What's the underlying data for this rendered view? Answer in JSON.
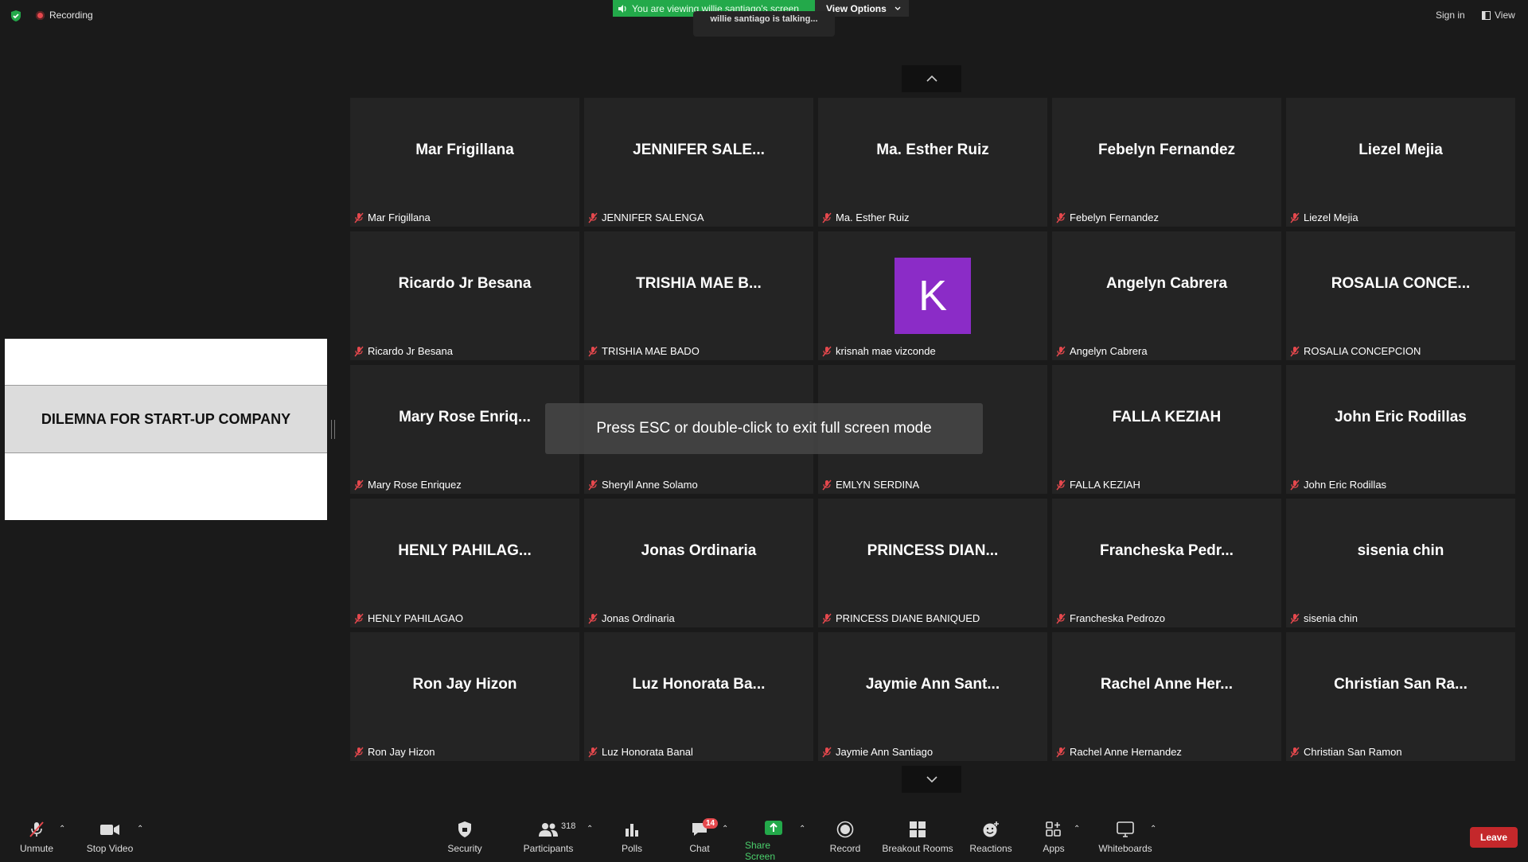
{
  "top": {
    "recording_label": "Recording",
    "viewing_text": "You are viewing willie santiago's screen",
    "view_options_label": "View Options",
    "talking_text": "willie santiago is talking...",
    "sign_in_label": "Sign in",
    "view_label": "View"
  },
  "share": {
    "slide_title": "DILEMNA FOR START-UP COMPANY"
  },
  "toast": {
    "text": "Press ESC or double-click to exit full screen mode"
  },
  "participants": [
    {
      "display": "Mar Frigillana",
      "label": "Mar Frigillana"
    },
    {
      "display": "JENNIFER  SALE...",
      "label": "JENNIFER SALENGA"
    },
    {
      "display": "Ma. Esther Ruiz",
      "label": "Ma. Esther Ruiz"
    },
    {
      "display": "Febelyn Fernandez",
      "label": "Febelyn Fernandez"
    },
    {
      "display": "Liezel Mejia",
      "label": "Liezel Mejia"
    },
    {
      "display": "Ricardo Jr Besana",
      "label": "Ricardo Jr Besana"
    },
    {
      "display": "TRISHIA MAE B...",
      "label": "TRISHIA MAE BADO"
    },
    {
      "display": "K",
      "label": "krisnah mae vizconde",
      "avatar": true
    },
    {
      "display": "Angelyn Cabrera",
      "label": "Angelyn Cabrera"
    },
    {
      "display": "ROSALIA  CONCE...",
      "label": "ROSALIA CONCEPCION"
    },
    {
      "display": "Mary Rose Enriq...",
      "label": "Mary Rose Enriquez"
    },
    {
      "display": "",
      "label": "Sheryll Anne Solamo"
    },
    {
      "display": "",
      "label": "EMLYN SERDINA"
    },
    {
      "display": "FALLA KEZIAH",
      "label": "FALLA KEZIAH"
    },
    {
      "display": "John Eric Rodillas",
      "label": "John Eric Rodillas"
    },
    {
      "display": "HENLY  PAHILAG...",
      "label": "HENLY PAHILAGAO"
    },
    {
      "display": "Jonas Ordinaria",
      "label": "Jonas Ordinaria"
    },
    {
      "display": "PRINCESS  DIAN...",
      "label": "PRINCESS DIANE BANIQUED"
    },
    {
      "display": "Francheska  Pedr...",
      "label": "Francheska Pedrozo"
    },
    {
      "display": "sisenia chin",
      "label": "sisenia chin"
    },
    {
      "display": "Ron Jay Hizon",
      "label": "Ron Jay Hizon"
    },
    {
      "display": "Luz  Honorata  Ba...",
      "label": "Luz Honorata Banal"
    },
    {
      "display": "Jaymie Ann Sant...",
      "label": "Jaymie Ann Santiago"
    },
    {
      "display": "Rachel Anne Her...",
      "label": "Rachel Anne Hernandez"
    },
    {
      "display": "Christian San Ra...",
      "label": "Christian San Ramon"
    }
  ],
  "toolbar": {
    "unmute": "Unmute",
    "stop_video": "Stop Video",
    "security": "Security",
    "participants": "Participants",
    "participants_count": "318",
    "polls": "Polls",
    "chat": "Chat",
    "chat_badge": "14",
    "share_screen": "Share Screen",
    "record": "Record",
    "breakout_rooms": "Breakout Rooms",
    "reactions": "Reactions",
    "apps": "Apps",
    "whiteboards": "Whiteboards",
    "leave": "Leave"
  },
  "colors": {
    "accent_green": "#23a94a",
    "avatar_purple": "#8b2cc7",
    "leave_red": "#c4282b",
    "muted_red": "#e5484d"
  }
}
